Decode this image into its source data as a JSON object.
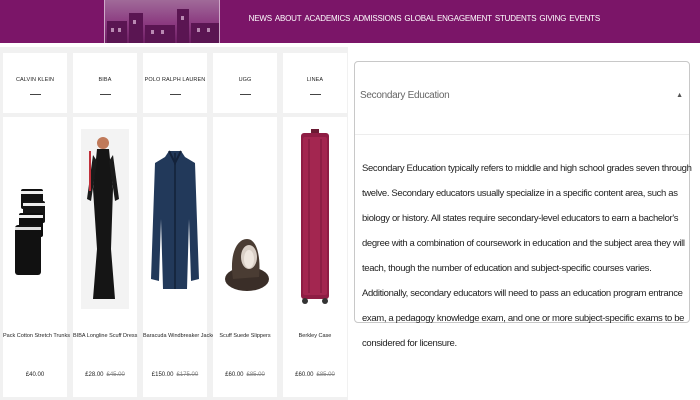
{
  "nav": {
    "items": [
      "NEWS",
      "ABOUT",
      "ACADEMICS",
      "ADMISSIONS",
      "GLOBAL ENGAGEMENT",
      "STUDENTS",
      "GIVING",
      "EVENTS"
    ]
  },
  "products": [
    {
      "brand": "CALVIN KLEIN",
      "name": "Pack Cotton Stretch Trunks",
      "price": "£40.00",
      "old_price": ""
    },
    {
      "brand": "BIBA",
      "name": "BIBA Longline Scuff Dress",
      "price": "£28.00",
      "old_price": "£45.00"
    },
    {
      "brand": "POLO RALPH LAUREN",
      "name": "Baracuda Windbreaker Jacket",
      "price": "£150.00",
      "old_price": "£175.00"
    },
    {
      "brand": "UGG",
      "name": "Scuff Suede Slippers",
      "price": "£60.00",
      "old_price": "£85.00"
    },
    {
      "brand": "LINEA",
      "name": "Berkley Case",
      "price": "£60.00",
      "old_price": "£85.00"
    }
  ],
  "panel": {
    "title": "Secondary Education",
    "caret": "▲",
    "body": "Secondary Education typically refers to middle and high school grades seven through twelve. Secondary educators usually specialize in a specific content area, such as biology or history. All states require secondary-level educators to earn a bachelor's degree with a combination of coursework in education and the subject area they will teach, though the number of education and subject-specific courses varies. Additionally, secondary educators will need to pass an education program entrance exam, a pedagogy knowledge exam, and one or more subject-specific exams to be considered for licensure."
  }
}
